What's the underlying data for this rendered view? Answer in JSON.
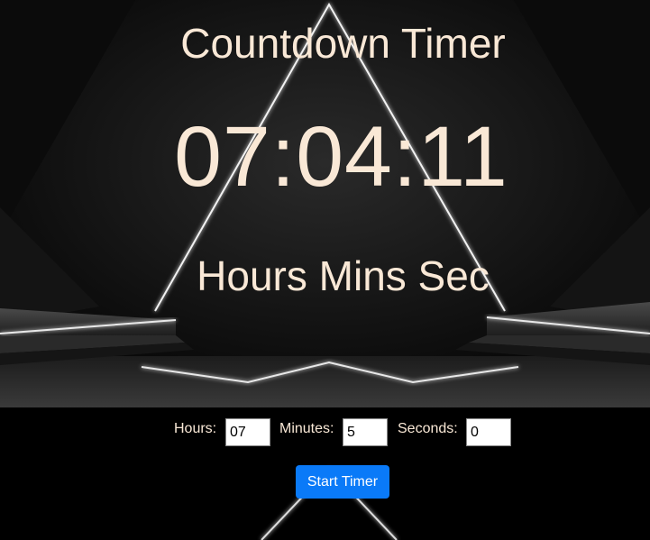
{
  "title": "Countdown Timer",
  "display": {
    "time": "07:04:11",
    "units": "Hours Mins Sec"
  },
  "controls": {
    "hours_label": "Hours:",
    "hours_value": "07",
    "minutes_label": "Minutes:",
    "minutes_value": "5",
    "seconds_label": "Seconds:",
    "seconds_value": "0",
    "start_label": "Start Timer"
  },
  "colors": {
    "text": "#f9e8d6",
    "background": "#000000",
    "button": "#0a7af8",
    "neon": "#ffffff"
  }
}
